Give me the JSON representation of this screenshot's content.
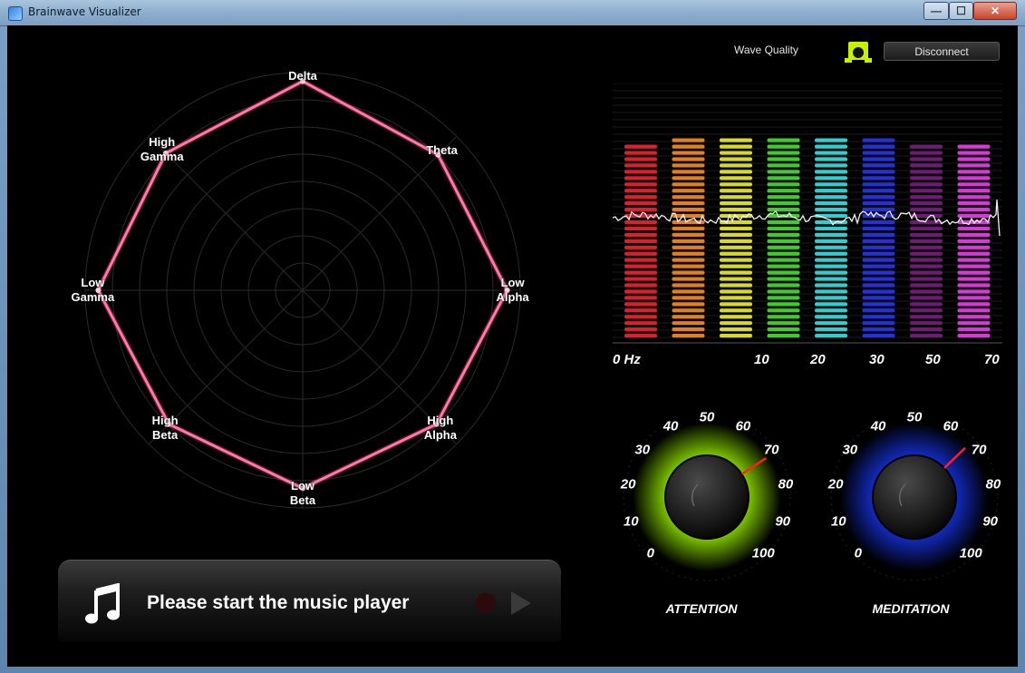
{
  "window": {
    "title": "Brainwave Visualizer",
    "min_glyph": "—",
    "max_glyph": "☐",
    "close_glyph": "✕"
  },
  "radar": {
    "bands": [
      {
        "key": "delta",
        "label": "Delta",
        "value": 0.96
      },
      {
        "key": "theta",
        "label": "Theta",
        "value": 0.88
      },
      {
        "key": "low_alpha",
        "label": "Low\nAlpha",
        "value": 0.94
      },
      {
        "key": "high_alpha",
        "label": "High\nAlpha",
        "value": 0.87
      },
      {
        "key": "low_beta",
        "label": "Low\nBeta",
        "value": 0.91
      },
      {
        "key": "high_beta",
        "label": "High\nBeta",
        "value": 0.87
      },
      {
        "key": "low_gamma",
        "label": "Low\nGamma",
        "value": 0.94
      },
      {
        "key": "high_gamma",
        "label": "High\nGamma",
        "value": 0.89
      }
    ],
    "line_color": "#ff7aa6"
  },
  "status": {
    "wave_quality_label": "Wave Quality",
    "wave_quality_color": "#c8f000",
    "disconnect_label": "Disconnect"
  },
  "spectrum": {
    "hz_labels": [
      "0 Hz",
      "10",
      "20",
      "30",
      "50",
      "70"
    ],
    "columns": [
      {
        "color": "#d9202c",
        "level": 0.97
      },
      {
        "color": "#e0801f",
        "level": 1.0
      },
      {
        "color": "#d8d826",
        "level": 1.0
      },
      {
        "color": "#3ecc2a",
        "level": 1.0
      },
      {
        "color": "#2fcfcf",
        "level": 1.0
      },
      {
        "color": "#2530d8",
        "level": 1.0
      },
      {
        "color": "#6c1c72",
        "level": 0.97
      },
      {
        "color": "#d838d8",
        "level": 0.97
      }
    ]
  },
  "dials": {
    "ticks": [
      "0",
      "10",
      "20",
      "30",
      "40",
      "50",
      "60",
      "70",
      "80",
      "90",
      "100"
    ],
    "attention": {
      "title": "ATTENTION",
      "value": 71,
      "glow": "#8fe000"
    },
    "meditation": {
      "title": "MEDITATION",
      "value": 67,
      "glow": "#1530d8"
    }
  },
  "music": {
    "message": "Please start the music player"
  }
}
